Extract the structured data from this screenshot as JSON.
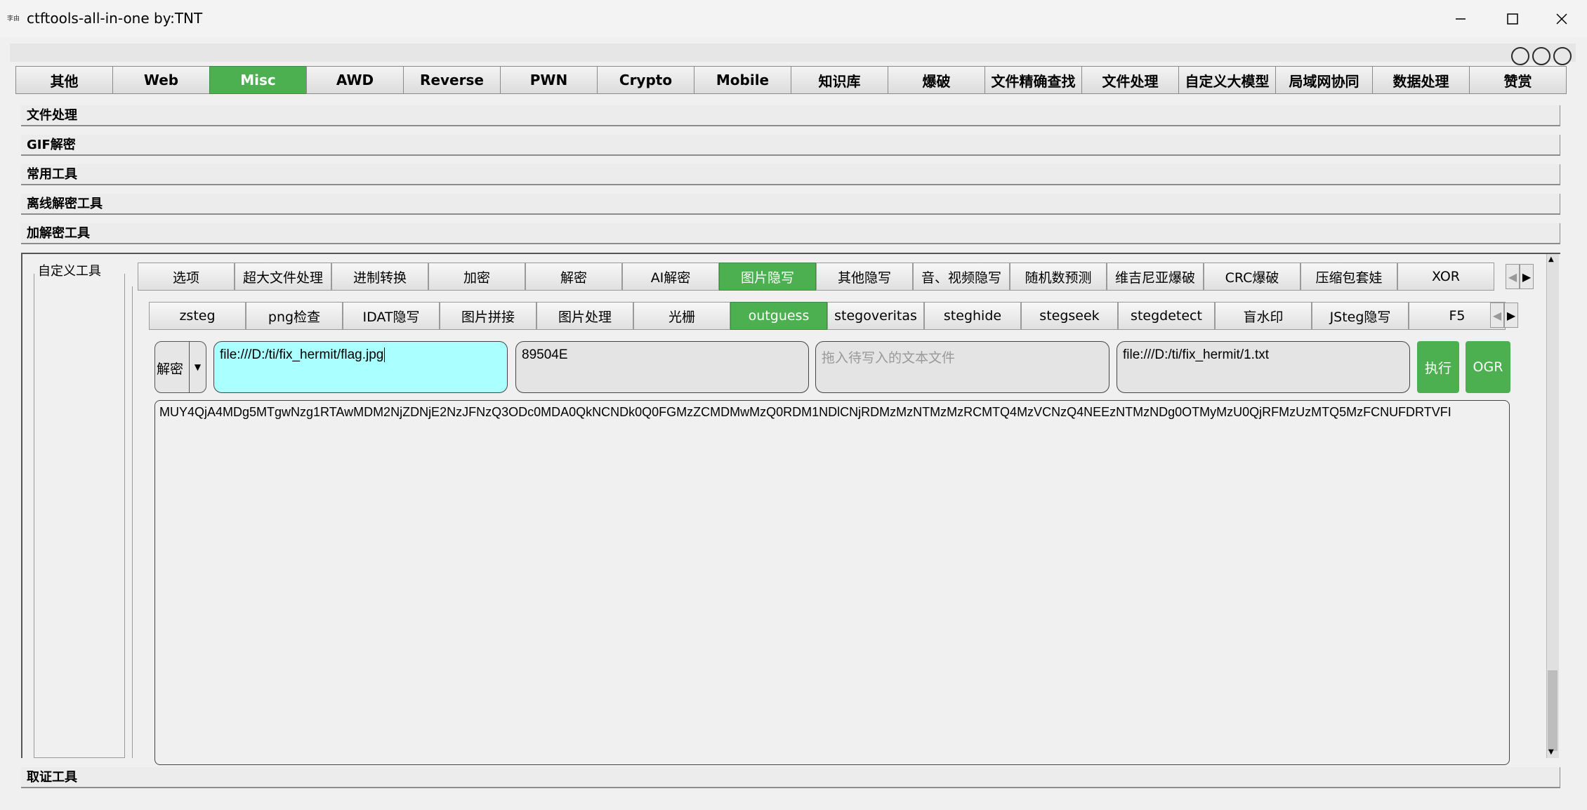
{
  "window": {
    "icon_text": "李由",
    "title": "ctftools-all-in-one   by:TNT"
  },
  "main_tabs": [
    "其他",
    "Web",
    "Misc",
    "AWD",
    "Reverse",
    "PWN",
    "Crypto",
    "Mobile",
    "知识库",
    "爆破",
    "文件精确查找",
    "文件处理",
    "自定义大模型",
    "局域网协同",
    "数据处理",
    "赞赏"
  ],
  "main_tab_active": "Misc",
  "sections": [
    "文件处理",
    "GIF解密",
    "常用工具",
    "离线解密工具",
    "加解密工具"
  ],
  "left_group_label": "自定义工具",
  "sub_tabs": [
    "选项",
    "超大文件处理",
    "进制转换",
    "加密",
    "解密",
    "AI解密",
    "图片隐写",
    "其他隐写",
    "音、视频隐写",
    "随机数预测",
    "维吉尼亚爆破",
    "CRC爆破",
    "压缩包套娃",
    "XOR"
  ],
  "sub_tab_active": "图片隐写",
  "stego_tabs": [
    "zsteg",
    "png检查",
    "IDAT隐写",
    "图片拼接",
    "图片处理",
    "光栅",
    "outguess",
    "stegoveritas",
    "steghide",
    "stegseek",
    "stegdetect",
    "盲水印",
    "JSteg隐写",
    "F5"
  ],
  "stego_tab_active": "outguess",
  "form": {
    "mode": "解密",
    "input_file": "file:///D:/ti/fix_hermit/flag.jpg",
    "key": "89504E",
    "text_file_placeholder": "拖入待写入的文本文件",
    "output_file": "file:///D:/ti/fix_hermit/1.txt",
    "run_label": "执行",
    "ogr_label": "OGR"
  },
  "output_text": "MUY4QjA4MDg5MTgwNzg1RTAwMDM2NjZDNjE2NzJFNzQ3ODc0MDA0QkNCNDk0Q0FGMzZCMDMwMzQ0RDM1NDlCNjRDMzMzNTMzMzRCMTQ4MzVCNzQ4NEEzNTMzNDg0OTMyMzU0QjRFMzUzMTQ5MzFCNUFDRTVFI",
  "bottom_section": "取证工具",
  "colors": {
    "accent": "#4caf50",
    "input_highlight": "#aaffff"
  }
}
